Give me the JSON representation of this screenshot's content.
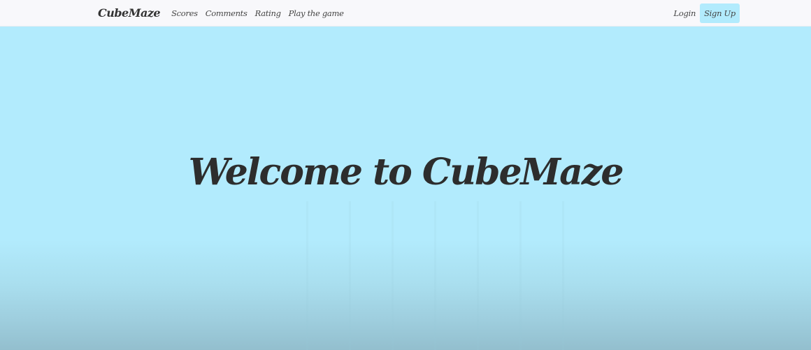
{
  "navbar": {
    "brand": "CubeMaze",
    "links": [
      {
        "label": "Scores"
      },
      {
        "label": "Comments"
      },
      {
        "label": "Rating"
      },
      {
        "label": "Play the game"
      }
    ],
    "login_label": "Login",
    "signup_label": "Sign Up"
  },
  "hero": {
    "title": "Welcome to CubeMaze"
  },
  "colors": {
    "background": "#b2ebfd",
    "navbar_background": "#f8f8fb",
    "signup_button": "#b2ebfd",
    "text": "#2d2d2d"
  }
}
